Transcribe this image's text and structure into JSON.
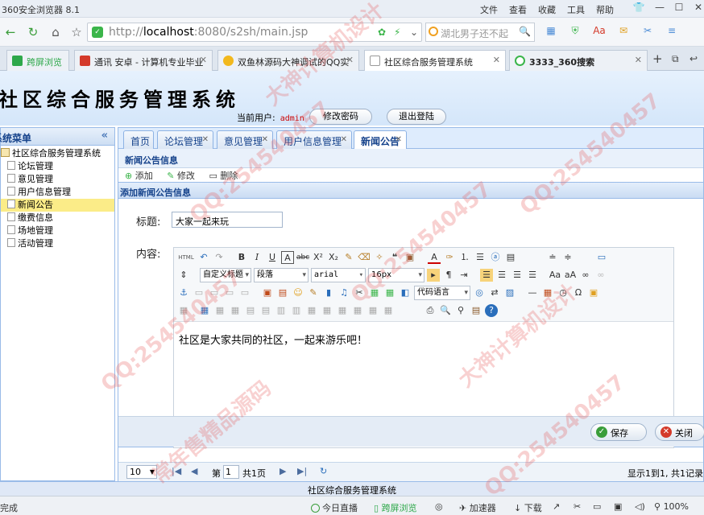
{
  "browser": {
    "app_title": "360安全浏览器 8.1",
    "menu": [
      "文件",
      "查看",
      "收藏",
      "工具",
      "帮助"
    ],
    "url_prefix": "http://",
    "url_host": "localhost",
    "url_rest": ":8080/s2sh/main.jsp",
    "search_placeholder": "湖北男子还不起",
    "tabs": [
      {
        "label": "跨屏浏览",
        "color": "#2ea84a"
      },
      {
        "label": "通讯 安卓 - 计算机专业毕业",
        "color": "#d43a2a"
      },
      {
        "label": "双鱼林源码大神调试的QQ实",
        "color": "#f2b81c"
      },
      {
        "label": "社区综合服务管理系统",
        "color": "#ffffff"
      },
      {
        "label": "3333_360搜索",
        "color": "#3bb54a"
      }
    ],
    "status": {
      "left": "完成",
      "live": "今日直播",
      "crossscreen": "跨屏浏览",
      "accelerator": "加速器",
      "download": "下载",
      "zoom": "100%"
    }
  },
  "app": {
    "title": "社区综合服务管理系统",
    "user_label": "当前用户:",
    "username": "admin",
    "change_password": "修改密码",
    "logout": "退出登陆",
    "footer": "社区综合服务管理系统"
  },
  "leftnav": {
    "header": "系统菜单",
    "root": "社区综合服务管理系统",
    "items": [
      "论坛管理",
      "意见管理",
      "用户信息管理",
      "新闻公告",
      "缴费信息",
      "场地管理",
      "活动管理"
    ],
    "selected_index": 3
  },
  "tabs": [
    {
      "label": "首页",
      "closable": false
    },
    {
      "label": "论坛管理",
      "closable": true
    },
    {
      "label": "意见管理",
      "closable": true
    },
    {
      "label": "用户信息管理",
      "closable": true
    },
    {
      "label": "新闻公告",
      "closable": true
    }
  ],
  "panel": {
    "header": "新闻公告信息",
    "tools": [
      "添加",
      "修改",
      "删除"
    ]
  },
  "modal": {
    "title": "添加新闻公告信息",
    "title_label": "标题:",
    "title_value": "大家一起来玩",
    "content_label": "内容:",
    "editor": {
      "custom_title": "自定义标题",
      "paragraph": "段落",
      "font": "arial",
      "size": "16px",
      "code_lang": "代码语言",
      "html_label": "HTML"
    },
    "content_text": "社区是大家共同的社区，一起来游乐吧！",
    "save": "保存",
    "close": "关闭"
  },
  "pager": {
    "page_size": "10",
    "page_label": "第",
    "page_value": "1",
    "total_pages": "共1页",
    "summary": "显示1到1, 共1记录"
  },
  "watermark": {
    "qq": "QQ:254540457",
    "phrase1": "大神计算机设计",
    "phrase2": "常年售精品源码"
  }
}
